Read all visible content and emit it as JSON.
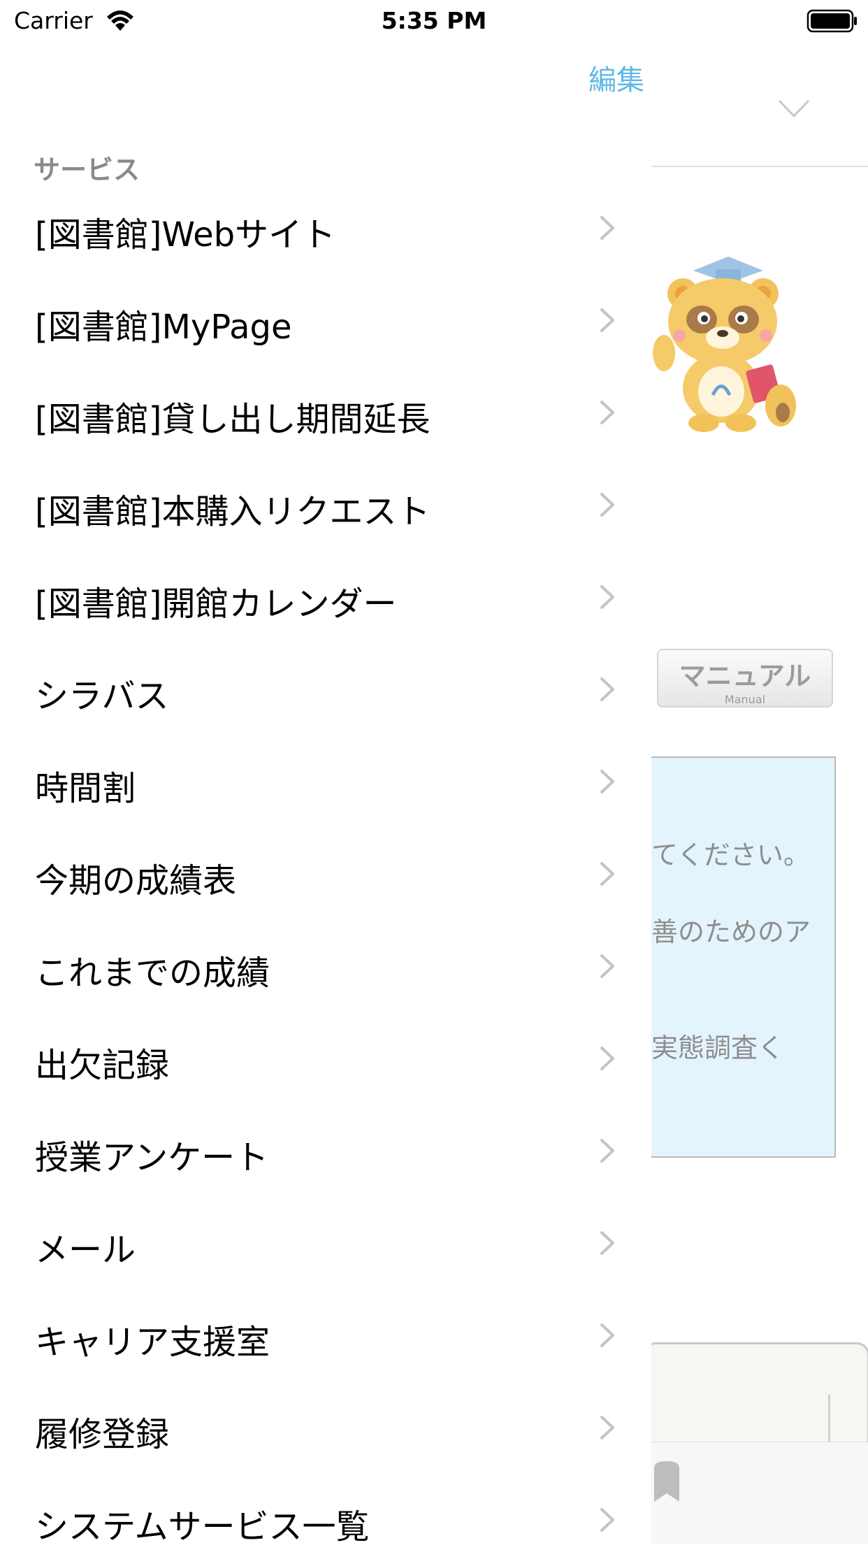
{
  "status_bar": {
    "carrier": "Carrier",
    "time": "5:35 PM"
  },
  "menu": {
    "edit_label": "編集",
    "section_title": "サービス",
    "items": [
      {
        "label": "[図書館]Webサイト"
      },
      {
        "label": "[図書館]MyPage"
      },
      {
        "label": "[図書館]貸し出し期間延長"
      },
      {
        "label": "[図書館]本購入リクエスト"
      },
      {
        "label": "[図書館]開館カレンダー"
      },
      {
        "label": "シラバス"
      },
      {
        "label": "時間割"
      },
      {
        "label": "今期の成績表"
      },
      {
        "label": "これまでの成績"
      },
      {
        "label": "出欠記録"
      },
      {
        "label": "授業アンケート"
      },
      {
        "label": "メール"
      },
      {
        "label": "キャリア支援室"
      },
      {
        "label": "履修登録"
      },
      {
        "label": "システムサービス一覧"
      }
    ]
  },
  "background": {
    "manual_button": {
      "label": "マニュアル",
      "sublabel": "Manual"
    },
    "notice_lines": [
      "てください。",
      "善のためのア",
      "実態調査く"
    ]
  },
  "colors": {
    "accent": "#5fb8e6",
    "notice_bg": "#e4f4fd",
    "section_header": "#8a8a8a",
    "chevron": "#c4c4c6"
  },
  "icons": {
    "wifi": "wifi-icon",
    "battery": "battery-icon",
    "chevron_right": "chevron-right-icon",
    "chevron_down": "chevron-down-icon",
    "mascot": "mascot-image",
    "bookmark": "bookmark-icon"
  }
}
